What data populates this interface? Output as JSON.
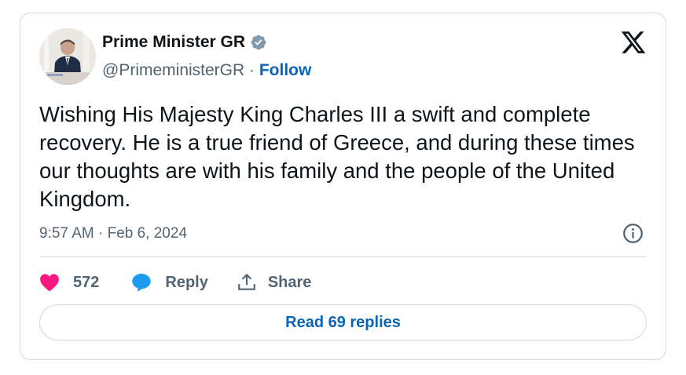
{
  "author": {
    "name": "Prime Minister GR",
    "handle": "@PrimeministerGR",
    "separator": " · ",
    "follow_label": "Follow"
  },
  "icons": {
    "avatar": "avatar-photo",
    "verified": "verified-badge-icon",
    "logo": "x-logo-icon",
    "info": "info-icon",
    "like": "heart-icon",
    "reply": "speech-bubble-icon",
    "share": "share-upload-icon"
  },
  "tweet": {
    "text": "Wishing His Majesty King Charles III a swift and complete recovery. He is a true friend of Greece, and during these times our thoughts are with his family and the people of the United Kingdom.",
    "timestamp": "9:57 AM · Feb 6, 2024"
  },
  "actions": {
    "like_count": "572",
    "reply_label": "Reply",
    "share_label": "Share"
  },
  "footer": {
    "read_replies_label": "Read 69 replies"
  },
  "colors": {
    "text_primary": "#0f1419",
    "text_secondary": "#536471",
    "link": "#0a65b6",
    "heart": "#f91880",
    "reply_bubble": "#1d9bf0",
    "verified_badge": "#829aab",
    "border": "#cfd9de"
  }
}
